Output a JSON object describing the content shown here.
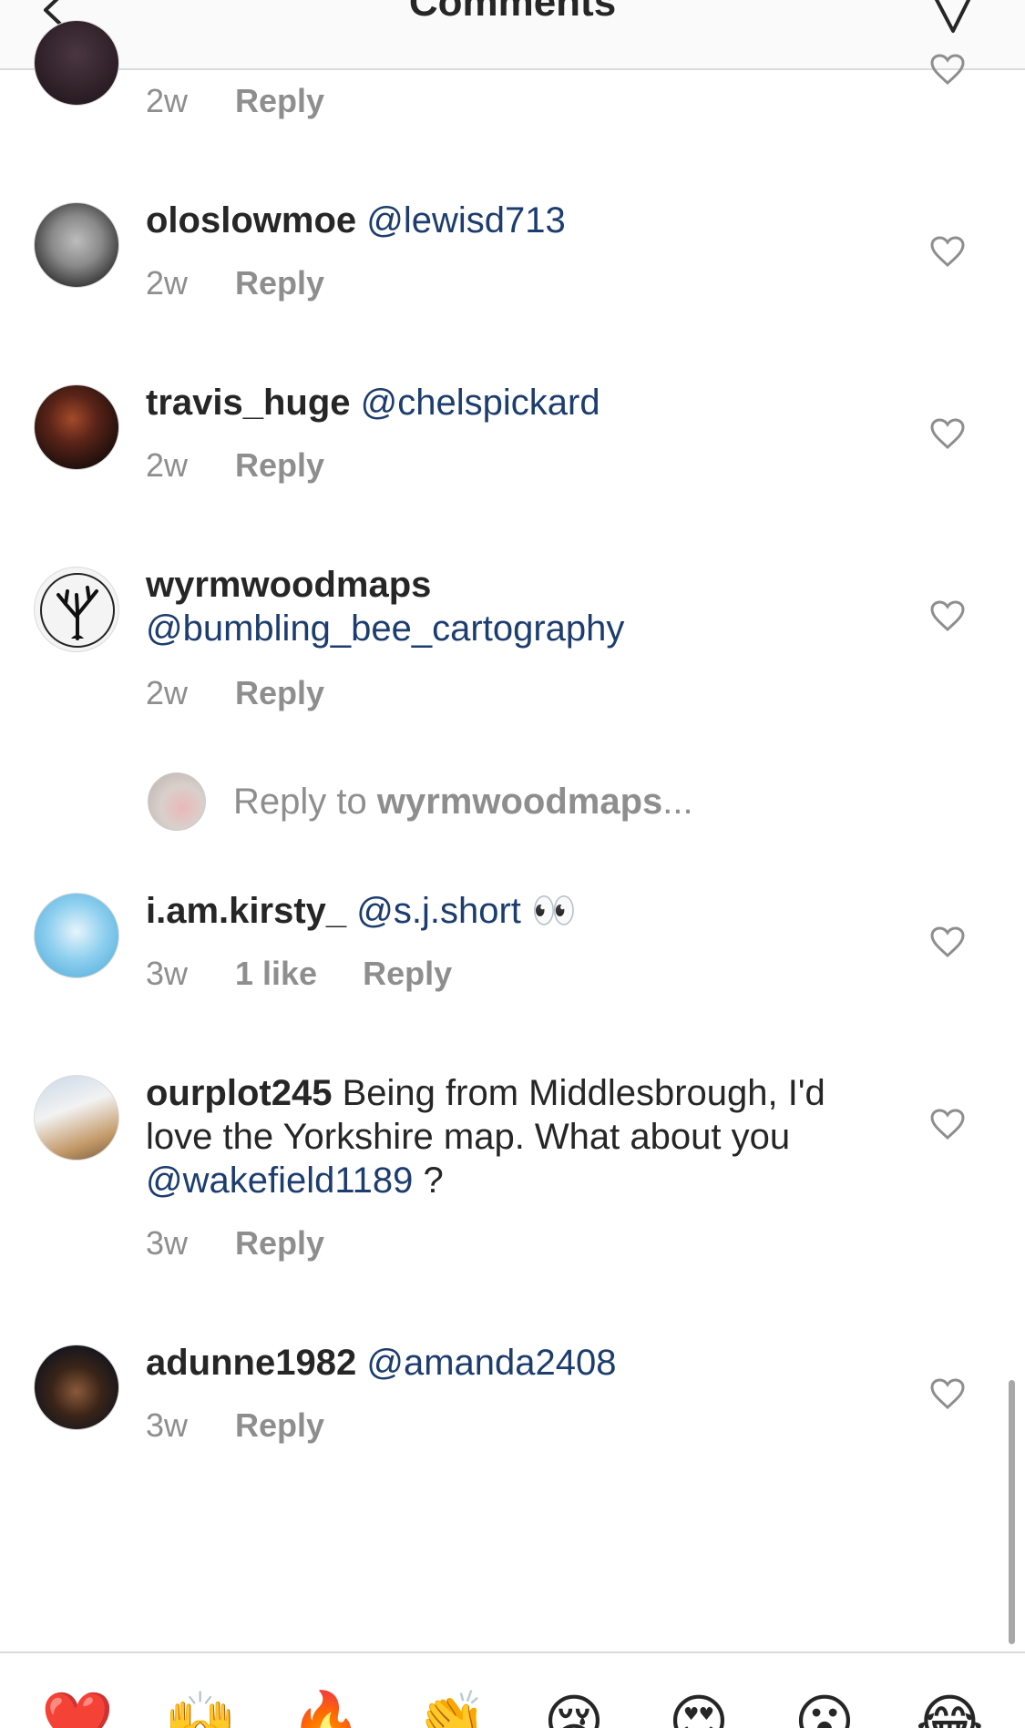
{
  "header": {
    "title": "Comments"
  },
  "top_partial": {
    "time": "2w",
    "reply": "Reply"
  },
  "comments": [
    {
      "username": "oloslowmoe",
      "mention": "@lewisd713",
      "text": "",
      "time": "2w",
      "likes": "",
      "reply": "Reply"
    },
    {
      "username": "travis_huge",
      "mention": "@chelspickard",
      "text": "",
      "time": "2w",
      "likes": "",
      "reply": "Reply"
    },
    {
      "username": "wyrmwoodmaps",
      "mention": "@bumbling_bee_cartography",
      "text": "",
      "time": "2w",
      "likes": "",
      "reply": "Reply"
    },
    {
      "username": "i.am.kirsty_",
      "mention": "@s.j.short",
      "text": "👀",
      "time": "3w",
      "likes": "1 like",
      "reply": "Reply"
    },
    {
      "username": "ourplot245",
      "text_before": "Being from Middlesbrough, I'd love the Yorkshire map. What about you",
      "mention": "@wakefield1189",
      "text_after": "?",
      "time": "3w",
      "likes": "",
      "reply": "Reply"
    },
    {
      "username": "adunne1982",
      "mention": "@amanda2408",
      "text": "",
      "time": "3w",
      "likes": "",
      "reply": "Reply"
    }
  ],
  "reply_prompt": {
    "prefix": "Reply to",
    "username": "wyrmwoodmaps",
    "suffix": "..."
  },
  "emoji_bar": [
    "❤️",
    "🙌",
    "🔥",
    "👏",
    "😢",
    "😍",
    "😮",
    "😂"
  ],
  "colors": {
    "mention": "#1c3d6e",
    "meta": "#8e8e8e",
    "text": "#262626",
    "divider": "#dbdbdb"
  }
}
